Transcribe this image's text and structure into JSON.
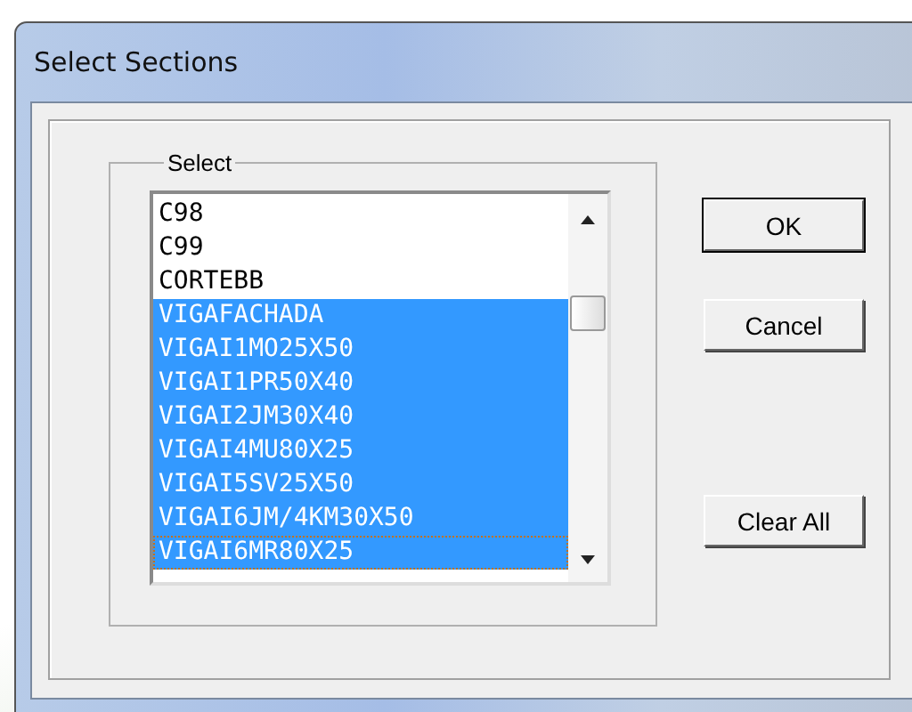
{
  "window": {
    "title": "Select Sections"
  },
  "group": {
    "label": "Select"
  },
  "list": [
    {
      "label": "C98",
      "selected": false,
      "focused": false
    },
    {
      "label": "C99",
      "selected": false,
      "focused": false
    },
    {
      "label": "CORTEBB",
      "selected": false,
      "focused": false
    },
    {
      "label": "VIGAFACHADA",
      "selected": true,
      "focused": false
    },
    {
      "label": "VIGAI1MO25X50",
      "selected": true,
      "focused": false
    },
    {
      "label": "VIGAI1PR50X40",
      "selected": true,
      "focused": false
    },
    {
      "label": "VIGAI2JM30X40",
      "selected": true,
      "focused": false
    },
    {
      "label": "VIGAI4MU80X25",
      "selected": true,
      "focused": false
    },
    {
      "label": "VIGAI5SV25X50",
      "selected": true,
      "focused": false
    },
    {
      "label": "VIGAI6JM/4KM30X50",
      "selected": true,
      "focused": false
    },
    {
      "label": "VIGAI6MR80X25",
      "selected": true,
      "focused": true
    }
  ],
  "buttons": [
    {
      "label": "OK",
      "default": true
    },
    {
      "label": "Cancel",
      "default": false
    },
    {
      "label": "Clear All",
      "default": false
    }
  ]
}
